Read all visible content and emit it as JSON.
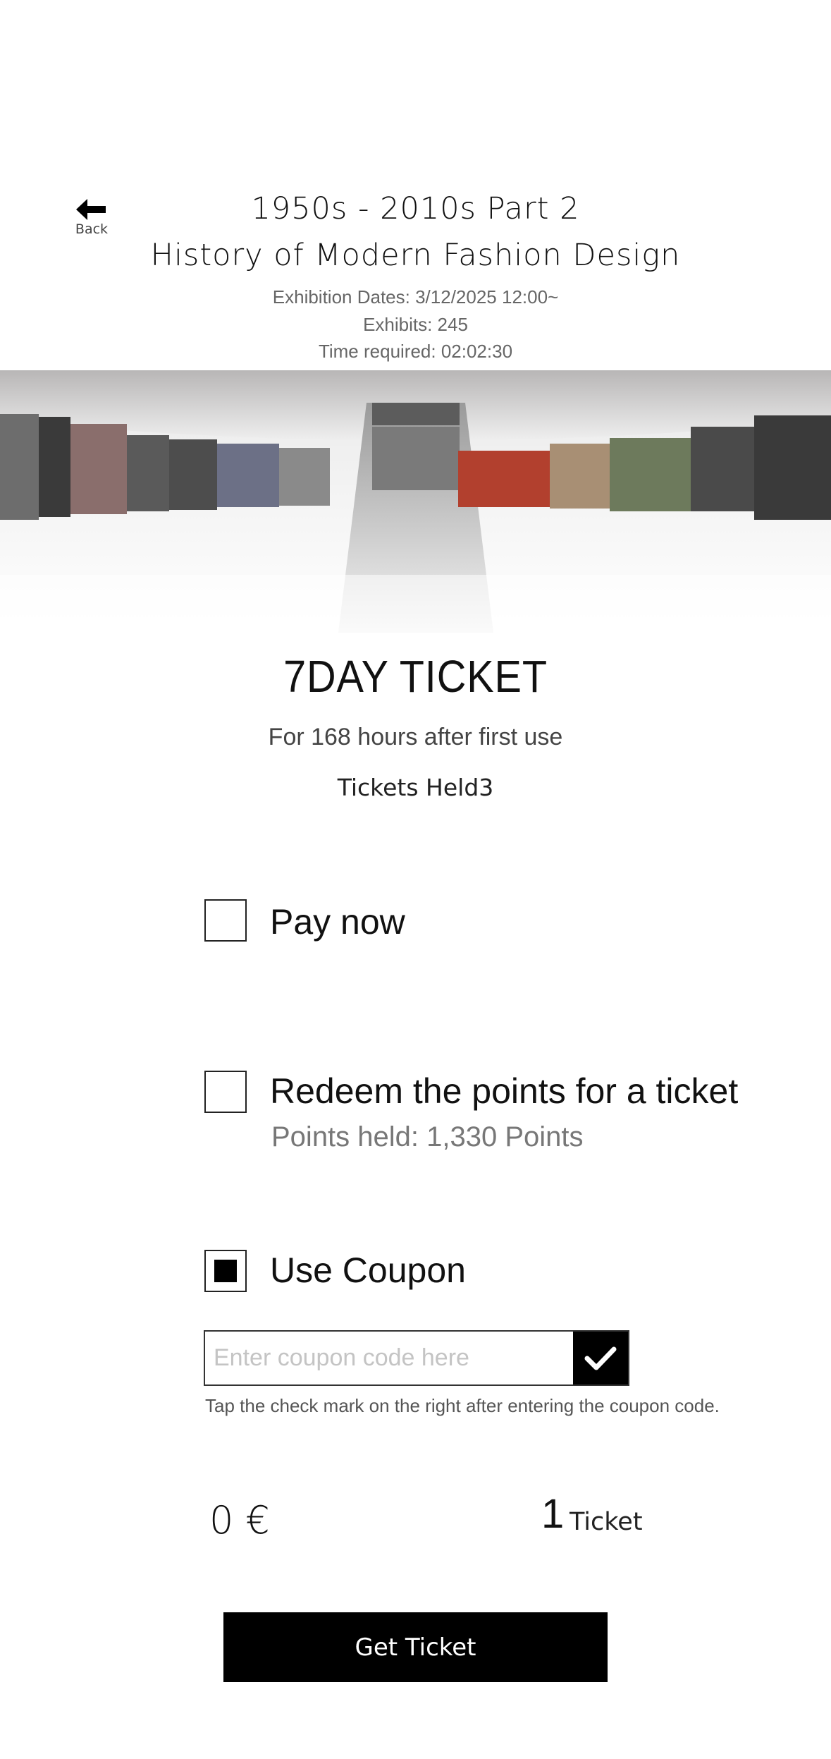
{
  "header": {
    "back_label": "Back",
    "title_line1": "1950s - 2010s Part 2",
    "title_line2": "History of Modern Fashion Design",
    "exhibition_dates": "Exhibition Dates: 3/12/2025 12:00~",
    "exhibits": "Exhibits: 245",
    "time_required": "Time required: 02:02:30"
  },
  "ticket": {
    "title": "7DAY TICKET",
    "subtitle": "For 168 hours after first use",
    "tickets_held": "Tickets Held3"
  },
  "options": [
    {
      "label": "Pay now",
      "checked": false
    },
    {
      "label": "Redeem the points for a ticket",
      "checked": false
    },
    {
      "label": "Use Coupon",
      "checked": true
    }
  ],
  "points_held": "Points held: 1,330 Points",
  "coupon": {
    "placeholder": "Enter coupon code here",
    "value": "",
    "hint": "Tap the check mark on the right after entering the coupon code."
  },
  "summary": {
    "price": "0 €",
    "quantity": "1",
    "quantity_unit": "Ticket"
  },
  "actions": {
    "get_ticket_label": "Get Ticket"
  },
  "icons": {
    "back": "arrow-left-icon",
    "coupon_apply": "checkmark-icon"
  },
  "colors": {
    "primary_button": "#000000",
    "muted_text": "#777777"
  }
}
